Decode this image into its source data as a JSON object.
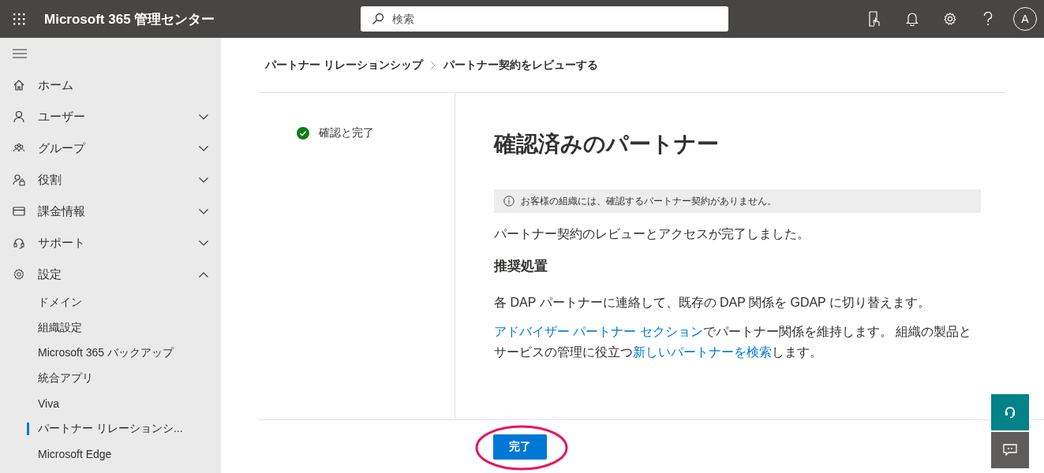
{
  "header": {
    "app_title": "Microsoft 365 管理センター",
    "search": {
      "placeholder": "検索"
    },
    "avatar": "A"
  },
  "sidebar": {
    "items": [
      {
        "kind": "home",
        "label": "ホーム"
      },
      {
        "kind": "user",
        "label": "ユーザー",
        "expanded": false
      },
      {
        "kind": "group",
        "label": "グループ",
        "expanded": false
      },
      {
        "kind": "role",
        "label": "役割",
        "expanded": false
      },
      {
        "kind": "billing",
        "label": "課金情報",
        "expanded": false
      },
      {
        "kind": "support",
        "label": "サポート",
        "expanded": false
      },
      {
        "kind": "settings",
        "label": "設定",
        "expanded": true,
        "children": [
          {
            "label": "ドメイン",
            "selected": false
          },
          {
            "label": "組織設定",
            "selected": false
          },
          {
            "label": "Microsoft 365 バックアップ",
            "selected": false
          },
          {
            "label": "統合アプリ",
            "selected": false
          },
          {
            "label": "Viva",
            "selected": false
          },
          {
            "label": "パートナー リレーションシ...",
            "selected": true
          },
          {
            "label": "Microsoft Edge",
            "selected": false
          }
        ]
      }
    ]
  },
  "breadcrumb": [
    "パートナー リレーションシップ",
    "パートナー契約をレビューする"
  ],
  "steps": [
    {
      "label": "確認と完了",
      "done": true
    }
  ],
  "panel": {
    "title": "確認済みのパートナー",
    "info": "お客様の組織には、確認するパートナー契約がありません。",
    "status": "パートナー契約のレビューとアクセスが完了しました。",
    "heading": "推奨処置",
    "instruction": "各 DAP パートナーに連絡して、既存の DAP 関係を GDAP に切り替えます。",
    "paragraph": [
      {
        "kind": "link",
        "text": "アドバイザー パートナー セクション"
      },
      {
        "kind": "text",
        "text": "でパートナー関係を維持します。 組織の製品とサービスの管理に役立つ"
      },
      {
        "kind": "link",
        "text": "新しいパートナーを検索"
      },
      {
        "kind": "text",
        "text": "します。"
      }
    ]
  },
  "footer": {
    "button": "完了"
  }
}
